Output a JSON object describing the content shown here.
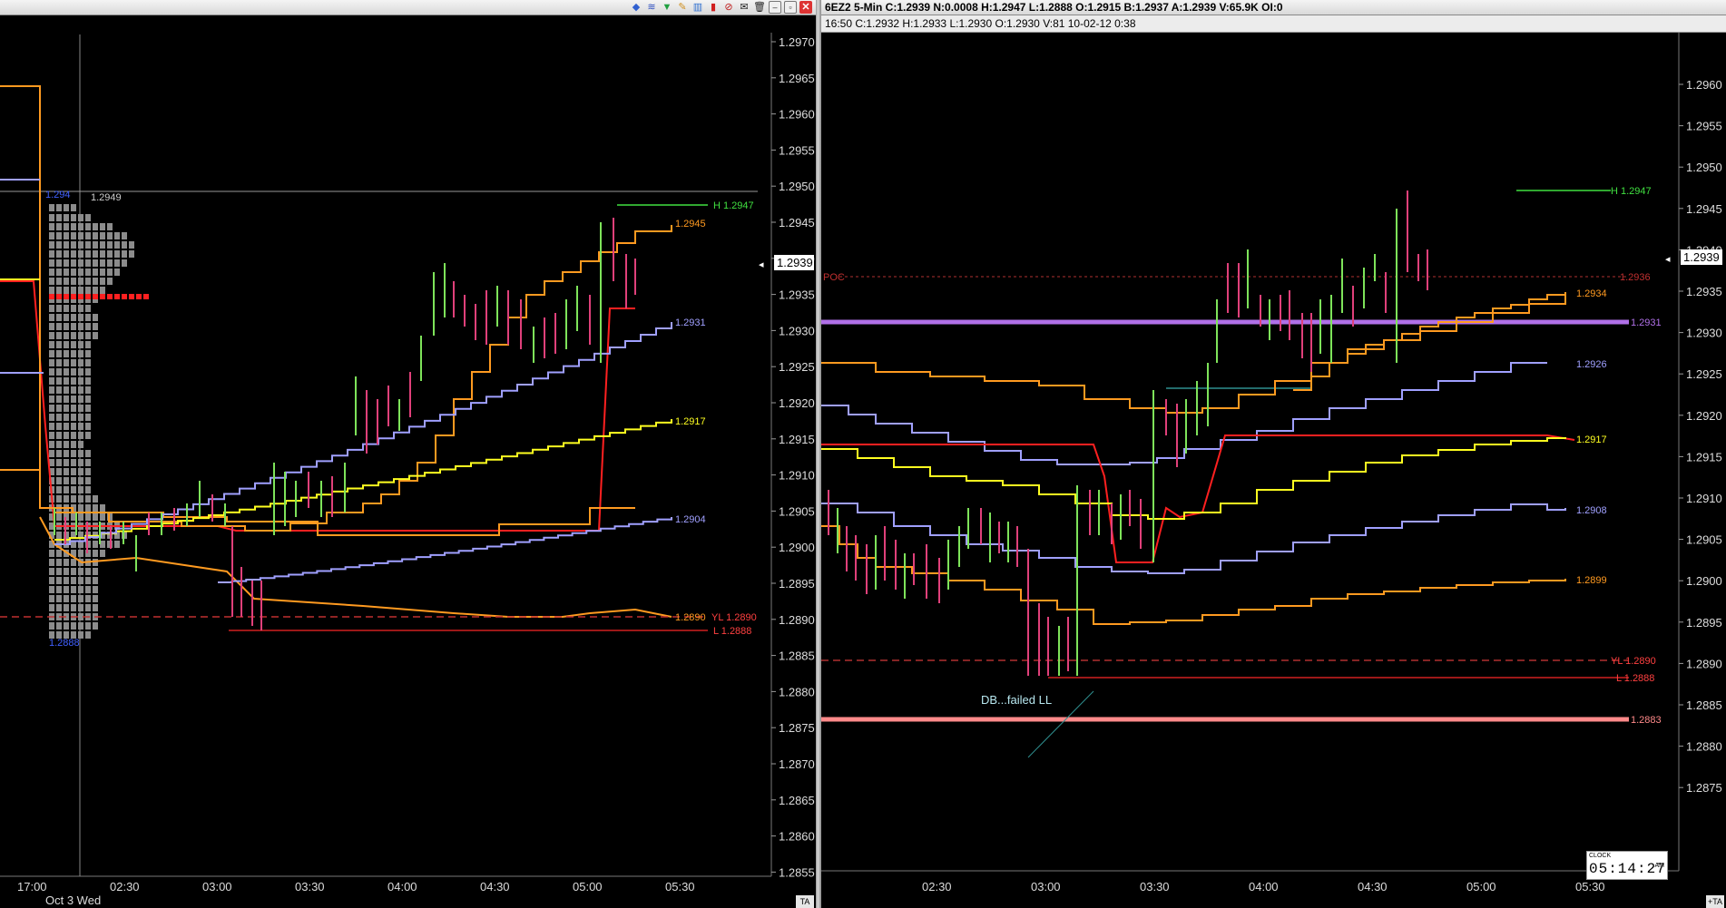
{
  "colors": {
    "bar_up": "#7ee35a",
    "bar_down": "#e0407a",
    "line_red": "#ff2020",
    "line_orange": "#ff9a20",
    "line_yellow": "#ffff20",
    "line_lavender": "#a0a0ff",
    "pivot_violet": "#b070e8",
    "support_pink": "#ff8a8a",
    "high_green": "#40e040"
  },
  "left_chart": {
    "price_axis": [
      "1.2970",
      "1.2965",
      "1.2960",
      "1.2955",
      "1.2950",
      "1.2945",
      "1.2940",
      "1.2935",
      "1.2930",
      "1.2925",
      "1.2920",
      "1.2915",
      "1.2910",
      "1.2905",
      "1.2900",
      "1.2895",
      "1.2890",
      "1.2885",
      "1.2880",
      "1.2875",
      "1.2870",
      "1.2865",
      "1.2860",
      "1.2855"
    ],
    "time_axis": [
      "17:00",
      "02:30",
      "03:00",
      "03:30",
      "04:00",
      "04:30",
      "05:00",
      "05:30"
    ],
    "date_label": "Oct 3 Wed",
    "current_price": "1.2939",
    "crosshair_price": "1.2949",
    "profile_high": "1.294",
    "profile_low": "1.2888",
    "line_labels": {
      "high": "H 1.2947",
      "orange": "1.2945",
      "lavender_upper": "1.2931",
      "yellow": "1.2917",
      "lavender_lower": "1.2904",
      "dashed": "1.2890",
      "yl": "YL 1.2890",
      "low": "L 1.2888"
    },
    "ta_label": "TA"
  },
  "right_chart": {
    "title": "6EZ2  5-Min  C:1.2939  N:0.0008  H:1.2947  L:1.2888  O:1.2915  B:1.2937  A:1.2939  V:65.9K  OI:0",
    "info": "16:50  C:1.2932  H:1.2933  L:1.2930  O:1.2930  V:81  10-02-12  0:38",
    "price_axis": [
      "1.2960",
      "1.2955",
      "1.2950",
      "1.2945",
      "1.2940",
      "1.2935",
      "1.2930",
      "1.2925",
      "1.2920",
      "1.2915",
      "1.2910",
      "1.2905",
      "1.2900",
      "1.2895",
      "1.2890",
      "1.2885",
      "1.2880",
      "1.2875"
    ],
    "time_axis": [
      "02:30",
      "03:00",
      "03:30",
      "04:00",
      "04:30",
      "05:00",
      "05:30"
    ],
    "current_price": "1.2939",
    "poc_label": "POC",
    "annotation": "DB...failed LL",
    "line_labels": {
      "high": "H 1.2947",
      "poc": "1.2936",
      "orange_upper": "1.2934",
      "pivot": "1.2931",
      "lavender_upper": "1.2926",
      "yellow": "1.2917",
      "lavender_lower": "1.2908",
      "orange_lower": "1.2899",
      "yl": "YL 1.2890",
      "low": "L 1.2888",
      "support": "1.2883"
    },
    "clock": {
      "label": "CLOCK",
      "time": "05:14:27",
      "ampm": "AM"
    },
    "ta_label": "+TA"
  },
  "toolbar_icons": [
    "diamond-icon",
    "waves-icon",
    "funnel-icon",
    "pencil-icon",
    "bars-icon",
    "candle-icon",
    "crosshair-icon",
    "notes-icon",
    "trash-icon",
    "minimize-icon",
    "restore-icon",
    "close-icon"
  ]
}
